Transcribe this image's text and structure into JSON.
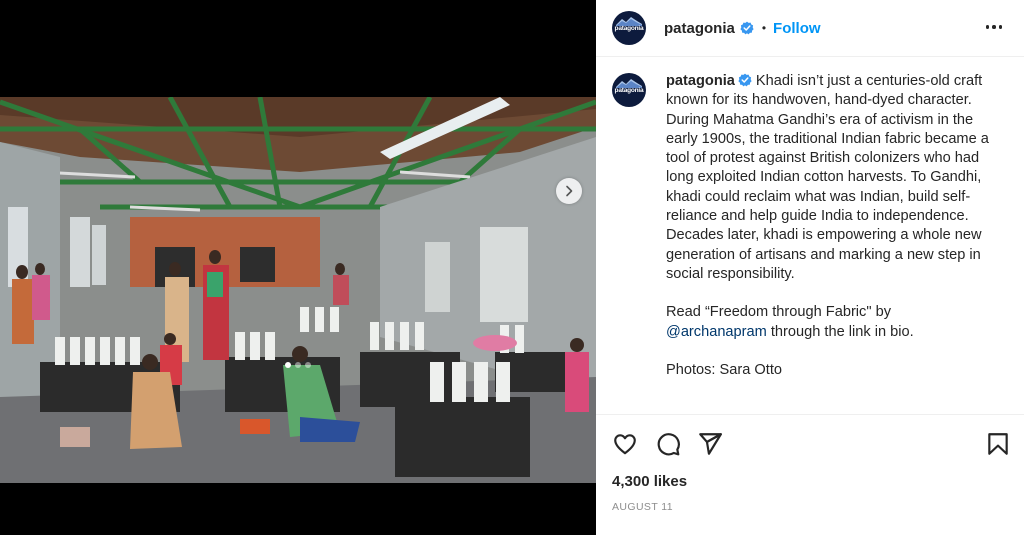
{
  "post": {
    "username": "patagonia",
    "follow_label": "Follow",
    "separator": "•",
    "avatar_logo_text": "patagonia",
    "caption": {
      "lines": [
        "Khadi isn’t just a centuries-old craft known for its handwoven, hand-dyed character. During Mahatma Gandhi’s era of activism in the early 1900s, the traditional Indian fabric became a tool of protest against British colonizers who had long exploited Indian cotton harvests. To Gandhi, khadi could reclaim what was Indian, build self-reliance and help guide India to independence. Decades later, khadi is empowering a whole new generation of artisans and marking a new step in social responsibility."
      ],
      "read_prefix": "Read “Freedom through Fabric\" by",
      "mention": "@archanapram",
      "read_suffix": " through the link in bio.",
      "photos_credit": "Photos: Sara Otto"
    },
    "likes": "4,300 likes",
    "date": "AUGUST 11",
    "carousel": {
      "total": 3,
      "active_index": 0
    }
  },
  "icons": {
    "more": "more-options-icon",
    "like": "heart-icon",
    "comment": "comment-icon",
    "share": "send-icon",
    "save": "bookmark-icon",
    "next": "chevron-right-icon",
    "verified": "verified-badge-icon"
  },
  "colors": {
    "accent": "#0095f6",
    "mention": "#00376b",
    "verified": "#3897f0",
    "text": "#262626",
    "muted": "#8e8e8e",
    "avatar_bg": "#0d1b3d"
  }
}
